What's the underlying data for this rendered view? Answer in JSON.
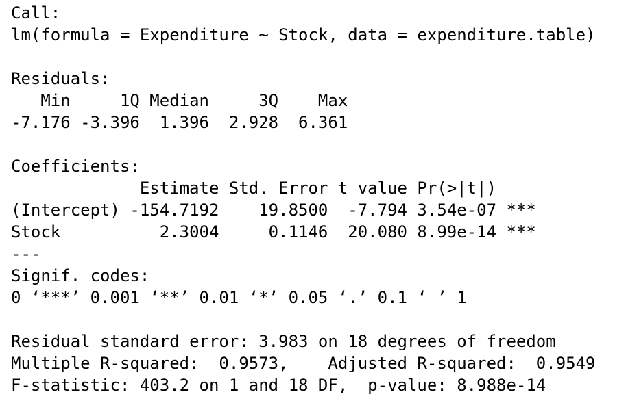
{
  "lines": [
    "Call:",
    "lm(formula = Expenditure ~ Stock, data = expenditure.table)",
    "",
    "Residuals:",
    "   Min     1Q Median     3Q    Max ",
    "-7.176 -3.396  1.396  2.928  6.361 ",
    "",
    "Coefficients:",
    "             Estimate Std. Error t value Pr(>|t|)    ",
    "(Intercept) -154.7192    19.8500  -7.794 3.54e-07 ***",
    "Stock          2.3004     0.1146  20.080 8.99e-14 ***",
    "---",
    "Signif. codes:  ",
    "0 ‘***’ 0.001 ‘**’ 0.01 ‘*’ 0.05 ‘.’ 0.1 ‘ ’ 1",
    "",
    "Residual standard error: 3.983 on 18 degrees of freedom",
    "Multiple R-squared:  0.9573,\tAdjusted R-squared:  0.9549 ",
    "F-statistic: 403.2 on 1 and 18 DF,  p-value: 8.988e-14"
  ]
}
